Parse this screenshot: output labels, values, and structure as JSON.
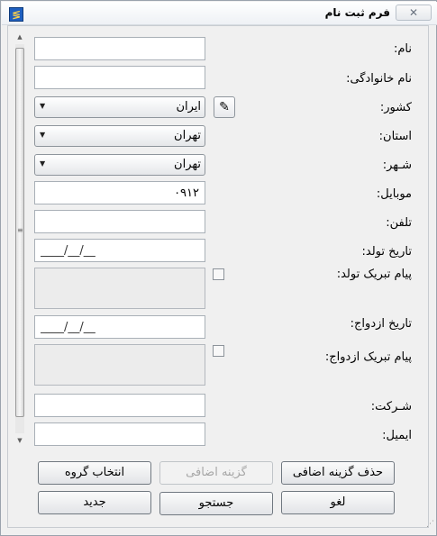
{
  "window": {
    "title": "فرم ثبت نام",
    "close_glyph": "✕",
    "app_glyph": "≶"
  },
  "labels": {
    "first_name": "نام:",
    "last_name": "نام خانوادگی:",
    "country": "کشور:",
    "province": "استان:",
    "city": "شـهر:",
    "mobile": "موبایل:",
    "phone": "تلفن:",
    "birth_date": "تاریخ تولد:",
    "birthday_message": "پیام تبریک تولد:",
    "marriage_date": "تاریخ ازدواج:",
    "anniversary_message": "پیام تبریک ازدواج:",
    "company": "شـرکت:",
    "email": "ایمیل:"
  },
  "values": {
    "first_name": "",
    "last_name": "",
    "country": "ایران",
    "province": "تهران",
    "city": "تهران",
    "mobile": "۰۹۱۲",
    "phone": "",
    "birth_date": "____/__/__",
    "marriage_date": "____/__/__",
    "company": "",
    "email": ""
  },
  "buttons": {
    "remove_extra_option": "حذف گزینه اضافی",
    "extra_option": "گزینه اضافی",
    "select_group": "انتخاب گروه",
    "cancel": "لغو",
    "search": "جستجو",
    "new": "جدید"
  },
  "icons": {
    "dropdown": "▼",
    "edit": "✎",
    "scroll_up": "▲",
    "scroll_down": "▼",
    "grip": "≡"
  }
}
